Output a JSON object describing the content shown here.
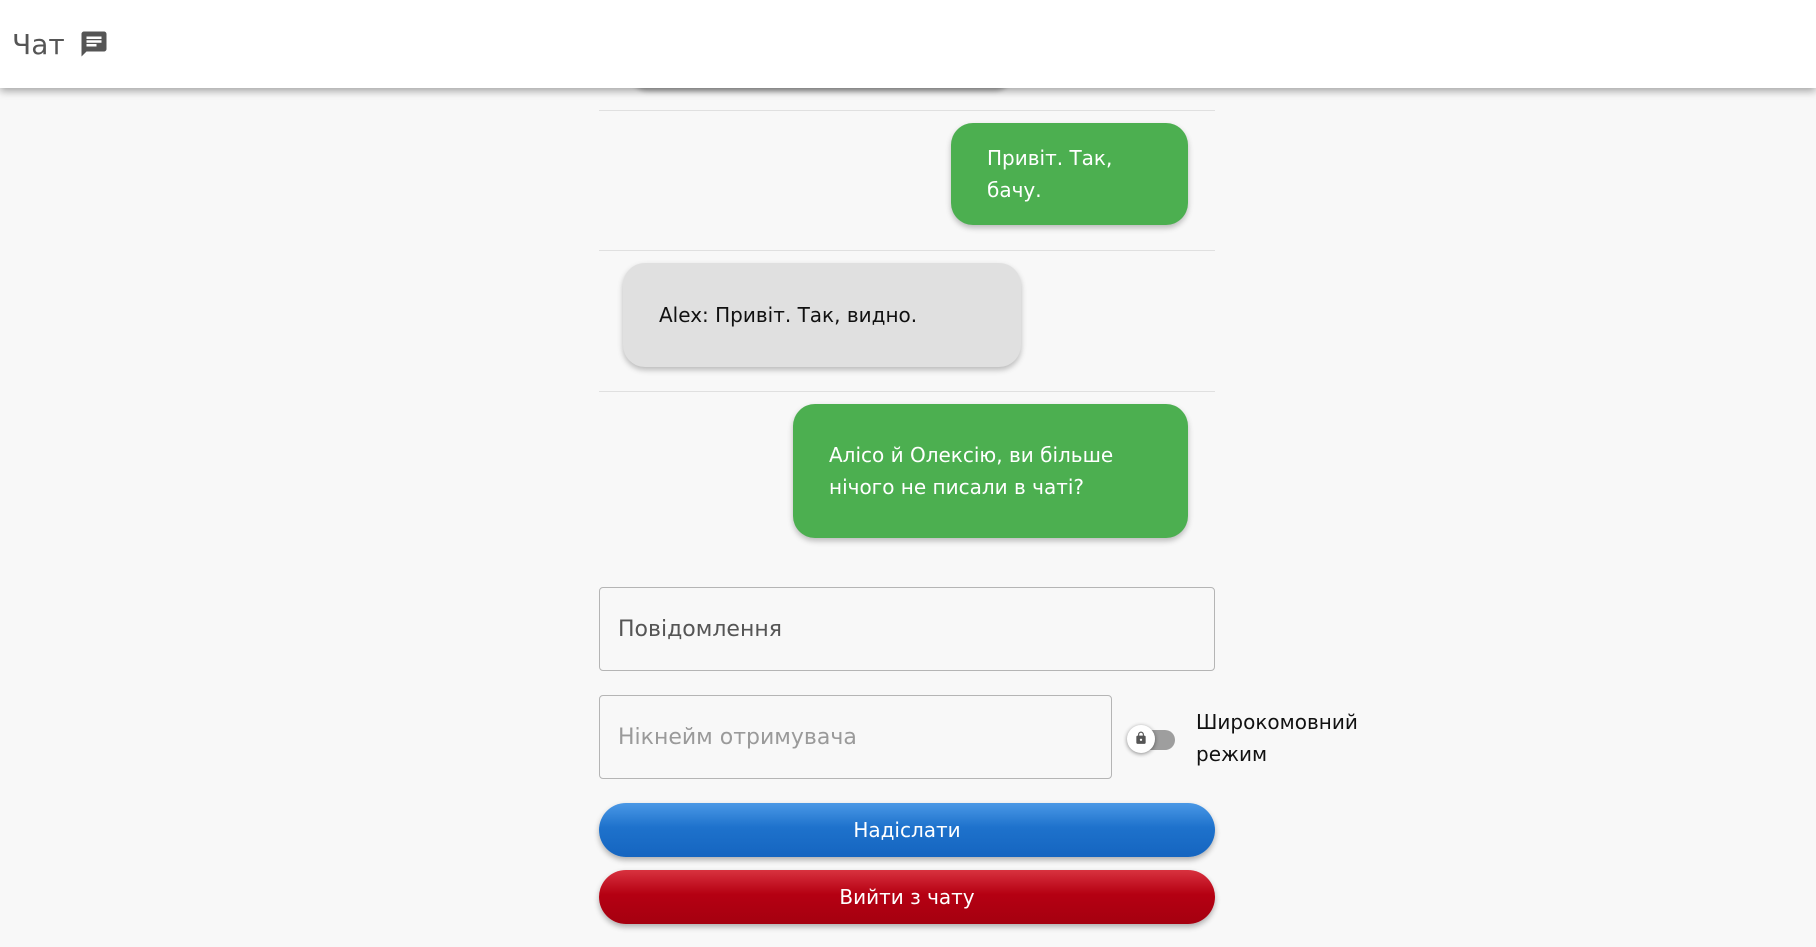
{
  "header": {
    "title": "Чат",
    "icon": "chat-icon"
  },
  "messages": [
    {
      "author": "self",
      "text": "Привіт. Так, бачу."
    },
    {
      "author": "other",
      "text": "Alex: Привіт. Так, видно."
    },
    {
      "author": "self",
      "text": "Алісо й Олексію, ви більше нічого не писали в чаті?"
    }
  ],
  "form": {
    "message_placeholder": "Повідомлення",
    "recipient_placeholder": "Нікнейм отримувача",
    "wide_mode_label": "Широкомовний режим",
    "wide_mode_enabled": false,
    "send_label": "Надіслати",
    "leave_label": "Вийти з чату"
  },
  "colors": {
    "own_bubble": "#4caf50",
    "other_bubble": "#e0e0e0",
    "send_button": "#1565c0",
    "leave_button": "#b50012"
  }
}
